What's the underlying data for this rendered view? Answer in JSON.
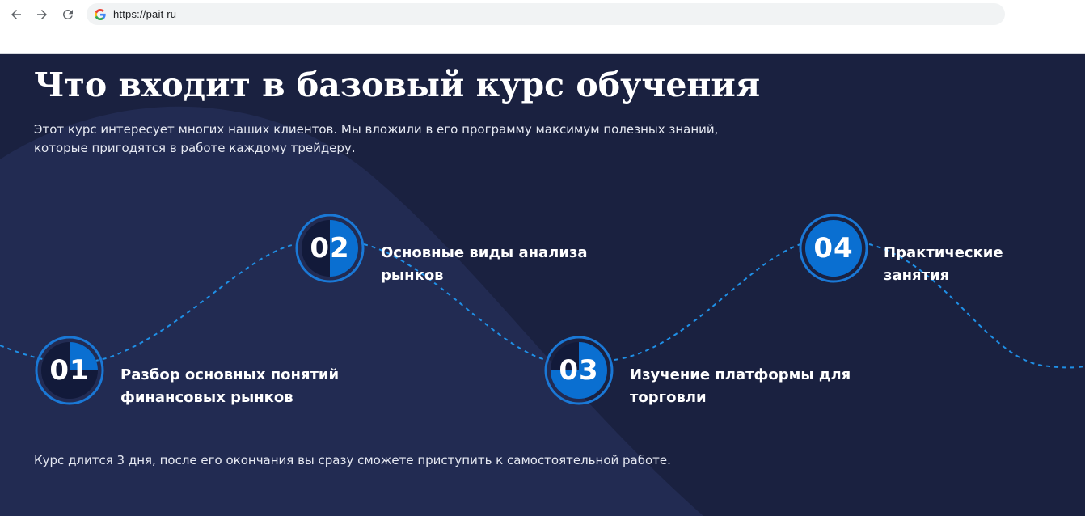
{
  "browser": {
    "url": "https://pait ru",
    "back_icon": "arrow-left-icon",
    "forward_icon": "arrow-right-icon",
    "reload_icon": "reload-icon",
    "site_icon": "google-icon"
  },
  "section": {
    "title": "Что входит в базовый курс обучения",
    "intro_line1": "Этот курс интересует многих наших клиентов. Мы вложили в его программу максимум полезных знаний,",
    "intro_line2": "которые пригодятся в работе каждому трейдеру.",
    "steps": [
      {
        "number": "01",
        "label_line1": "Разбор основных понятий",
        "label_line2": "финансовых рынков",
        "progress": 0.25
      },
      {
        "number": "02",
        "label_line1": "Основные виды анализа",
        "label_line2": "рынков",
        "progress": 0.5
      },
      {
        "number": "03",
        "label_line1": "Изучение платформы для",
        "label_line2": "торговли",
        "progress": 0.75
      },
      {
        "number": "04",
        "label_line1": "Практические",
        "label_line2": "занятия",
        "progress": 1.0
      }
    ],
    "footer": "Курс длится 3 дня, после его окончания вы сразу сможете приступить к самостоятельной работе."
  },
  "colors": {
    "background": "#1a2140",
    "background_shape": "#222b52",
    "accent": "#0a6fd1",
    "ring": "#1a78d6",
    "circle_fill": "#121a3a",
    "wave": "#1f8fe6",
    "text": "#ffffff"
  }
}
